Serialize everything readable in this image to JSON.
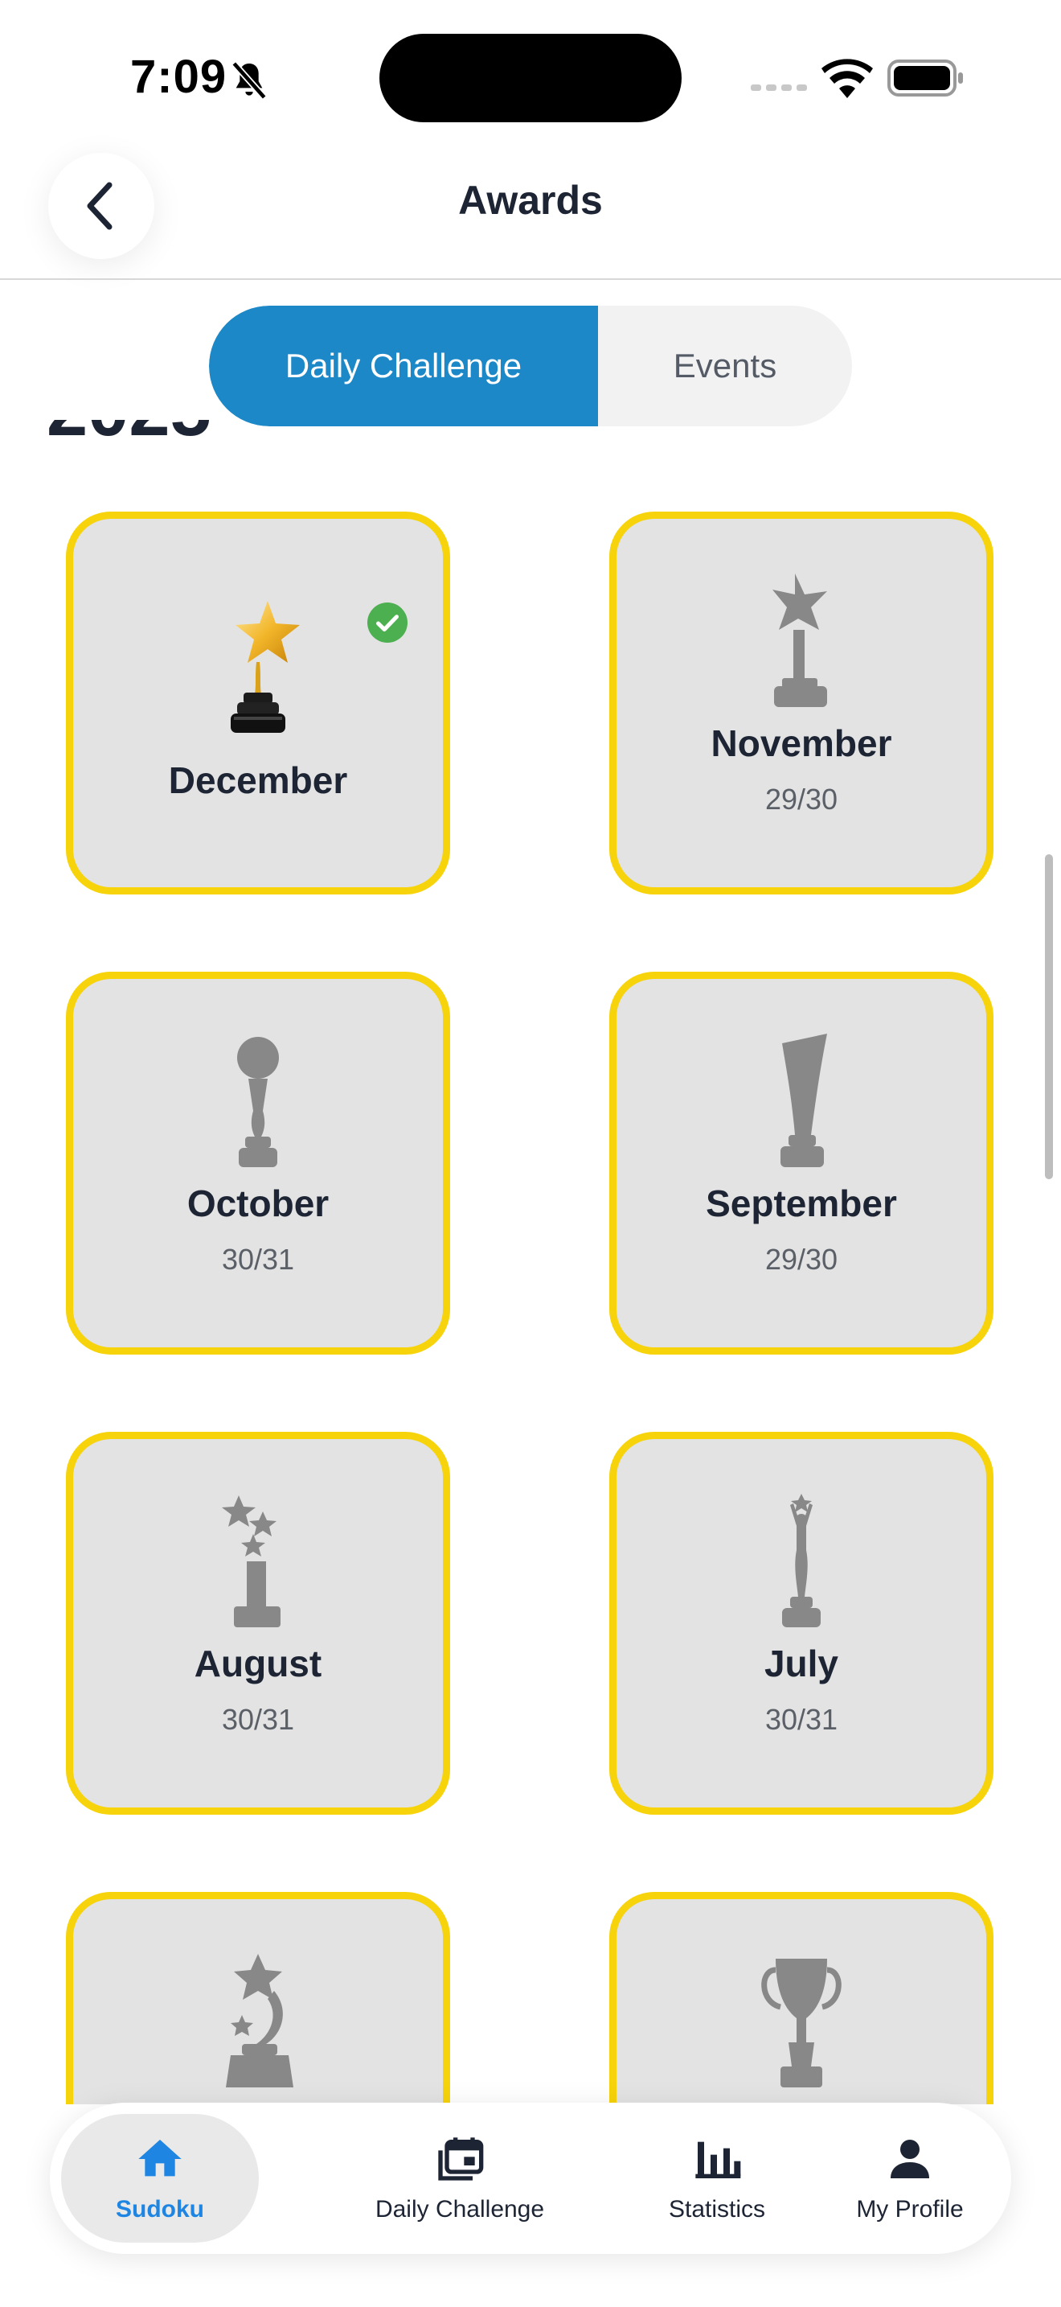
{
  "status_bar": {
    "time": "7:09"
  },
  "header": {
    "title": "Awards"
  },
  "tabs": [
    {
      "label": "Daily Challenge",
      "selected": true
    },
    {
      "label": "Events",
      "selected": false
    }
  ],
  "year_heading": "2025",
  "awards": [
    {
      "month": "December",
      "progress": "",
      "completed": true
    },
    {
      "month": "November",
      "progress": "29/30",
      "completed": false
    },
    {
      "month": "October",
      "progress": "30/31",
      "completed": false
    },
    {
      "month": "September",
      "progress": "29/30",
      "completed": false
    },
    {
      "month": "August",
      "progress": "30/31",
      "completed": false
    },
    {
      "month": "July",
      "progress": "30/31",
      "completed": false
    },
    {
      "month": "",
      "progress": "",
      "completed": false
    },
    {
      "month": "",
      "progress": "",
      "completed": false
    }
  ],
  "bottom_nav": [
    {
      "label": "Sudoku",
      "icon": "home-icon",
      "active": true
    },
    {
      "label": "Daily Challenge",
      "icon": "calendar-icon",
      "active": false
    },
    {
      "label": "Statistics",
      "icon": "bar-chart-icon",
      "active": false
    },
    {
      "label": "My Profile",
      "icon": "person-icon",
      "active": false
    }
  ],
  "colors": {
    "accent": "#1c88c7",
    "card_border": "#f6d30a",
    "card_bg": "#e3e3e3",
    "nav_active": "#1e86e2",
    "check": "#4caf50"
  }
}
